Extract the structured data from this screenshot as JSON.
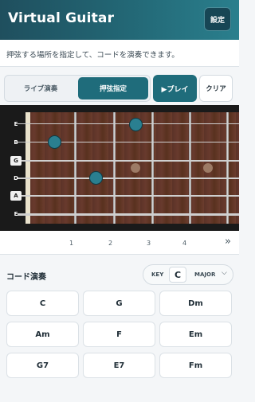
{
  "app": {
    "title": "Virtual Guitar",
    "settings_label": "設定"
  },
  "instruction": "押弦する場所を指定して、コードを演奏できます。",
  "modes": {
    "live": "ライブ演奏",
    "fret": "押弦指定",
    "play": "▶プレイ",
    "clear": "クリア"
  },
  "strings": [
    {
      "label": "E",
      "open": false
    },
    {
      "label": "B",
      "open": false
    },
    {
      "label": "G",
      "open": true
    },
    {
      "label": "D",
      "open": false
    },
    {
      "label": "A",
      "open": true
    },
    {
      "label": "E",
      "open": false
    }
  ],
  "fret_numbers": [
    "1",
    "2",
    "3",
    "4"
  ],
  "scroll_icon": "double-chevron-right-icon",
  "chord_section": {
    "title": "コード演奏",
    "key_label": "KEY",
    "key_value": "C",
    "mode_value": "MAJOR",
    "chords": [
      "C",
      "G",
      "Dm",
      "Am",
      "F",
      "Em",
      "G7",
      "E7",
      "Fm"
    ]
  },
  "colors": {
    "accent": "#1f6c7b",
    "header": "#236876",
    "finger_dot": "#2a7f90"
  }
}
